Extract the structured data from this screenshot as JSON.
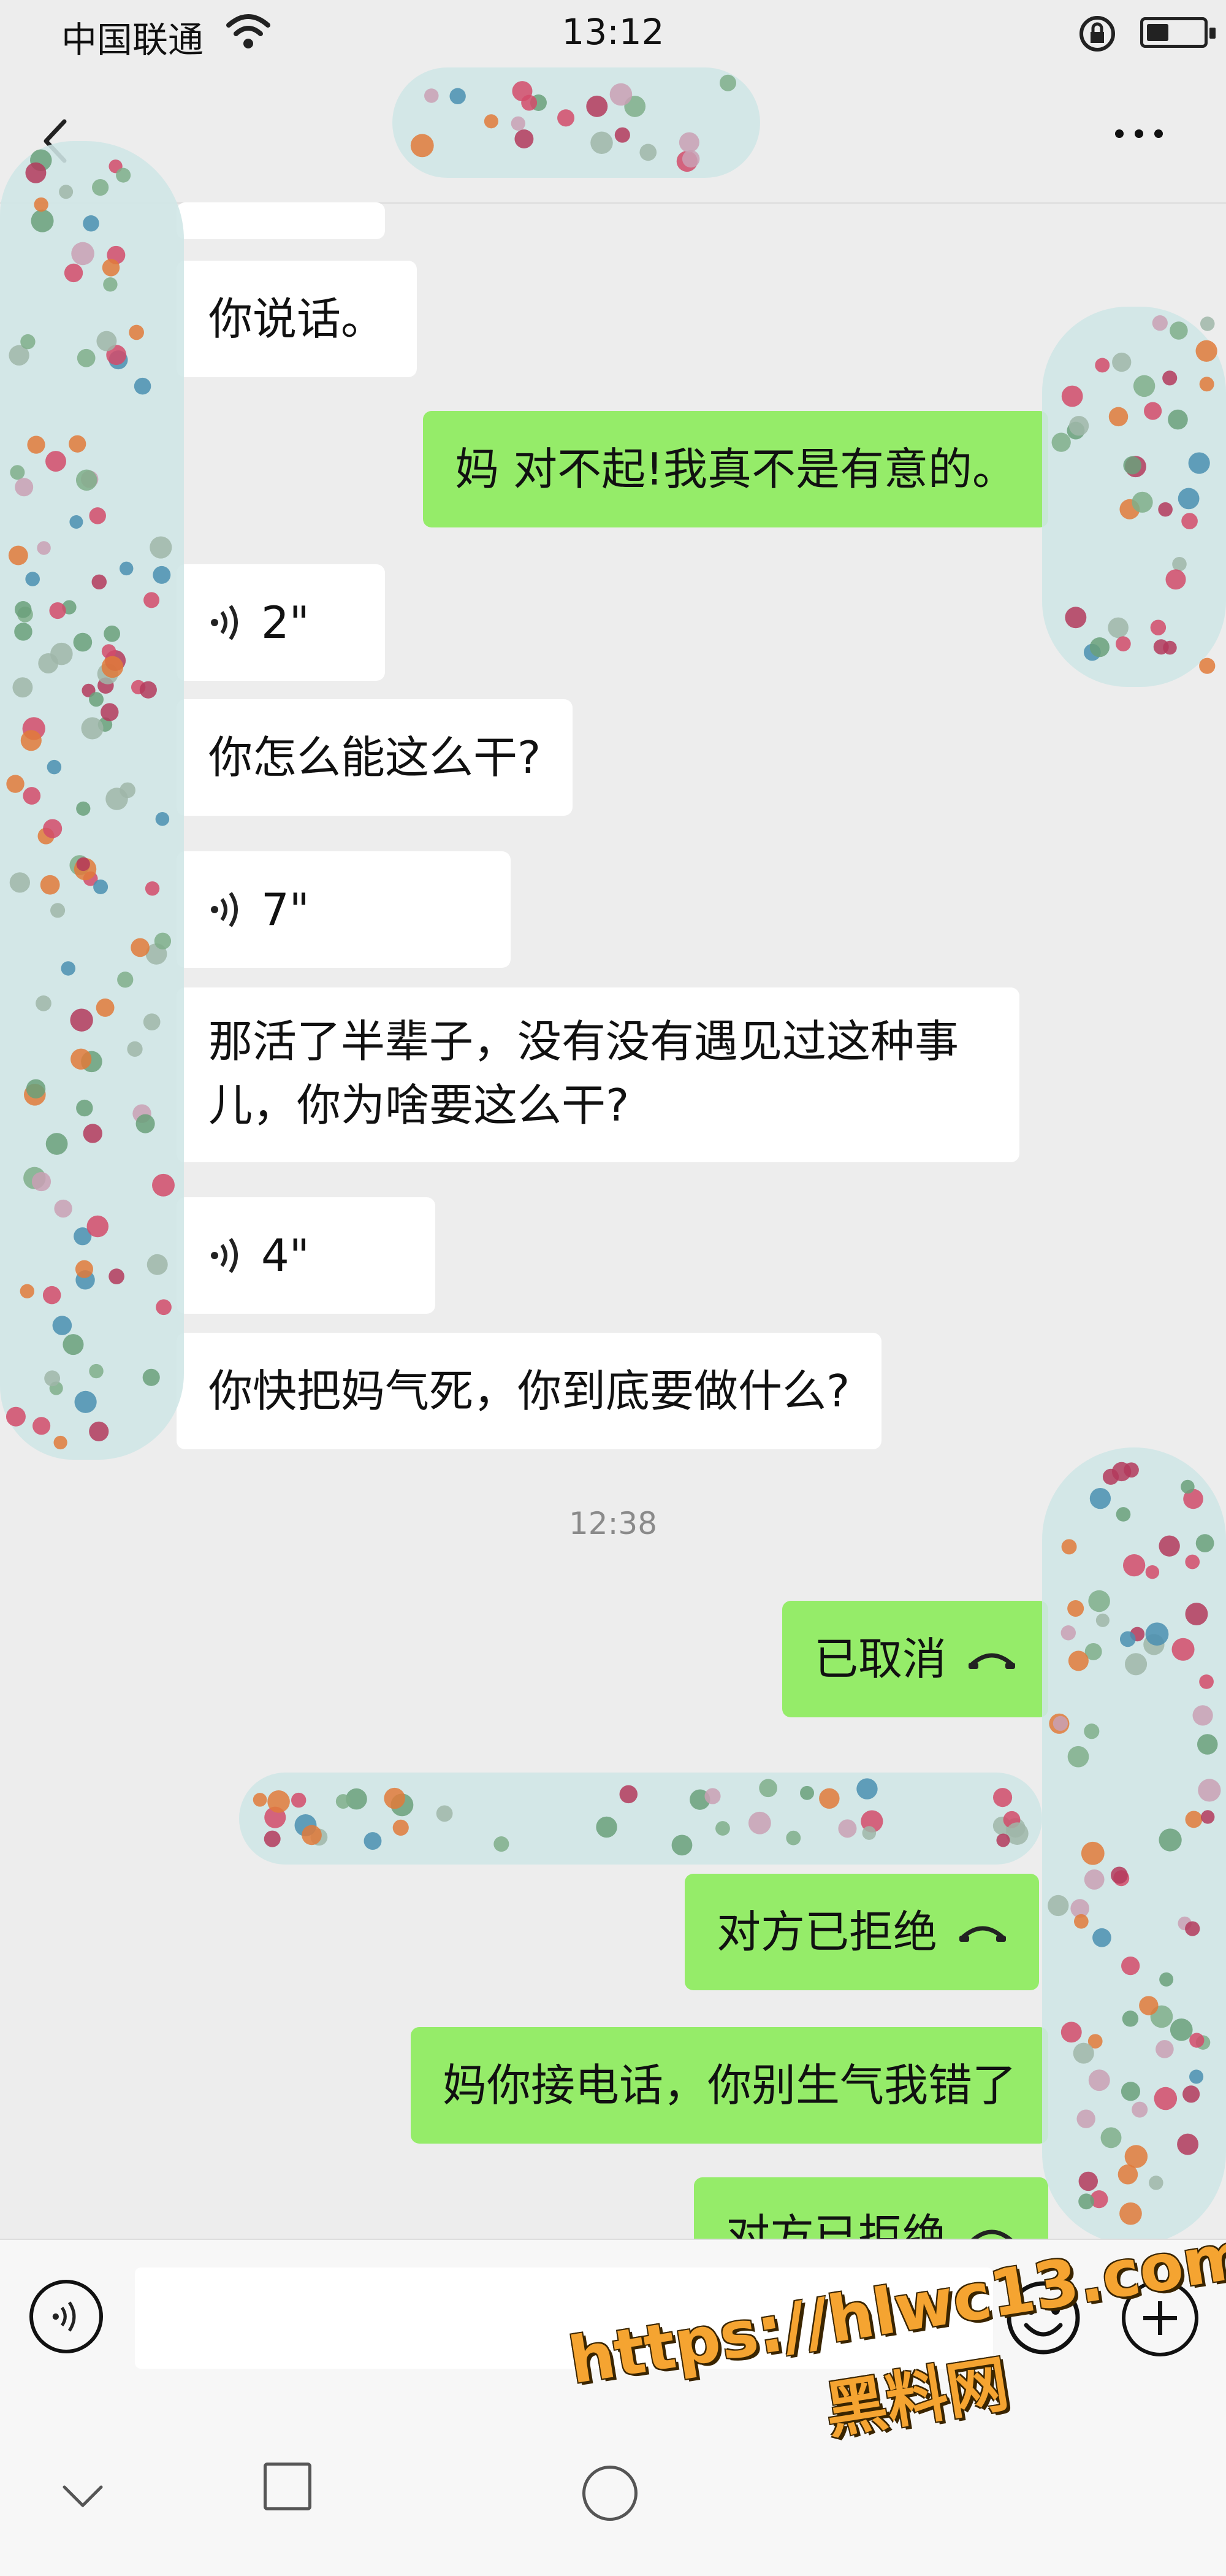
{
  "status_bar": {
    "carrier": "中国联通",
    "time": "13:12",
    "battery_percent": 40
  },
  "messages": [
    {
      "side": "in",
      "type": "text",
      "text": "你说话。"
    },
    {
      "side": "out",
      "type": "text",
      "text": "妈 对不起!我真不是有意的。"
    },
    {
      "side": "in",
      "type": "voice",
      "duration": "2\""
    },
    {
      "side": "in",
      "type": "text",
      "text": "你怎么能这么干?"
    },
    {
      "side": "in",
      "type": "voice",
      "duration": "7\""
    },
    {
      "side": "in",
      "type": "text",
      "lines": [
        "那活了半辈子，没有没有遇见过这种事",
        "儿，你为啥要这么干?"
      ]
    },
    {
      "side": "in",
      "type": "voice",
      "duration": "4\""
    },
    {
      "side": "in",
      "type": "text",
      "text": "你快把妈气死，你到底要做什么?"
    },
    {
      "type": "timestamp",
      "text": "12:38"
    },
    {
      "side": "out",
      "type": "call",
      "text": "已取消"
    },
    {
      "side": "out",
      "type": "call",
      "text": "对方已拒绝"
    },
    {
      "side": "out",
      "type": "text",
      "text": "妈你接电话，你别生气我错了"
    },
    {
      "side": "out",
      "type": "call",
      "text": "对方已拒绝"
    }
  ],
  "icons": [
    "back-icon",
    "more-icon",
    "voice-icon",
    "call-icon",
    "emoji-icon",
    "plus-icon",
    "chevron-down-icon",
    "square-icon",
    "circle-icon"
  ],
  "colors": {
    "background": "#ededed",
    "bubble_in": "#ffffff",
    "bubble_out": "#95ec69",
    "watermark": "#f5a431"
  },
  "watermark": {
    "url": "https://hlwc13.com",
    "name": "黑料网"
  }
}
